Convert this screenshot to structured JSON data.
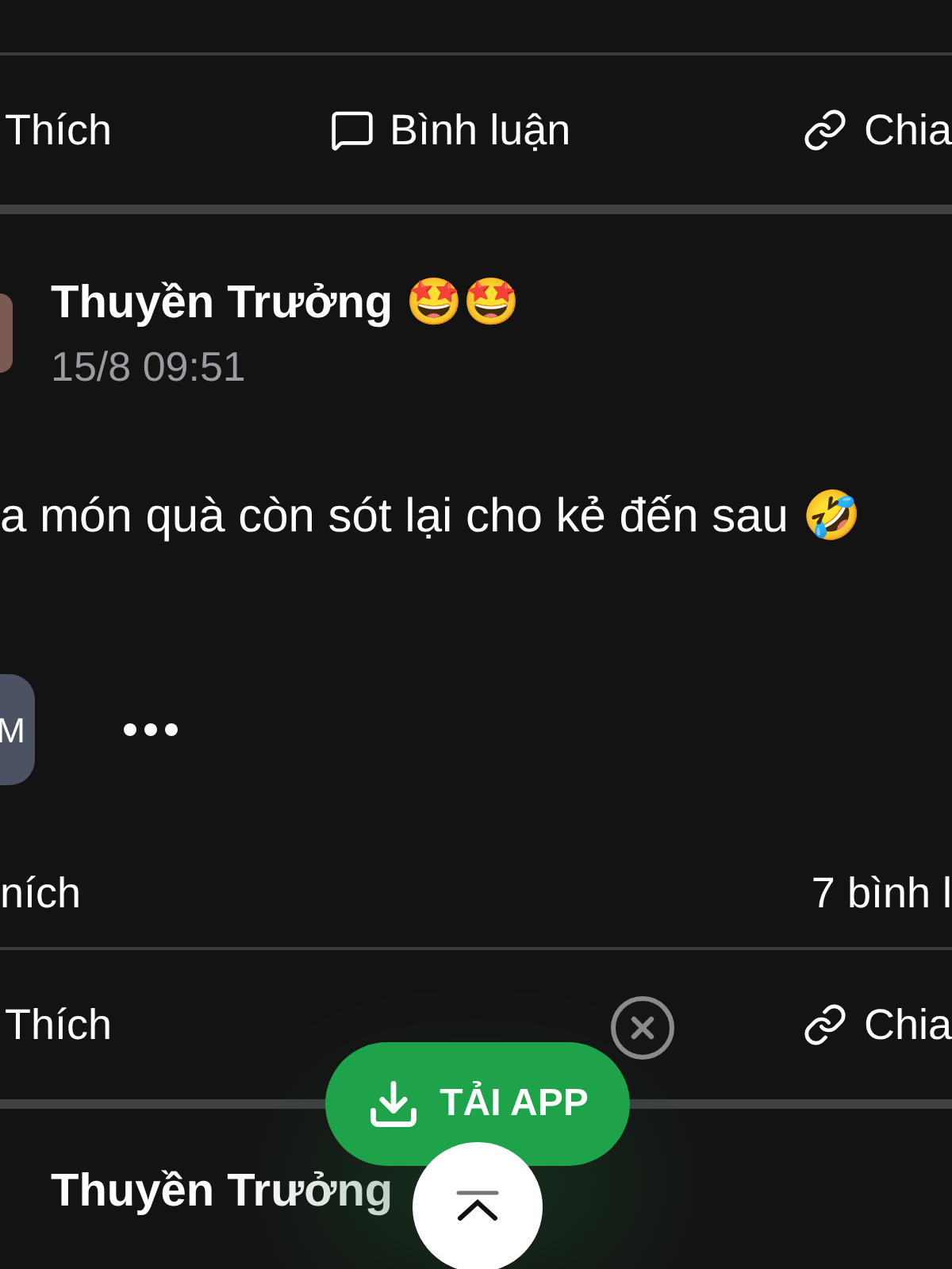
{
  "top_actions": [
    {
      "kind": "like",
      "label": "Thích"
    },
    {
      "kind": "comment",
      "label": "Bình luận"
    },
    {
      "kind": "share",
      "label": "Chia"
    }
  ],
  "post": {
    "author": "Thuyền Trưởng 🤩🤩",
    "time": "15/8 09:51",
    "body": "a món quà còn sót lại cho kẻ đến sau 🤣",
    "chip": "M",
    "likes": "ních",
    "comments": "7 bình l"
  },
  "bottom_actions": [
    {
      "kind": "like",
      "label": "Thích"
    },
    {
      "kind": "share",
      "label": "Chia"
    }
  ],
  "next_post": {
    "author": "Thuyền Trưởng"
  },
  "download_button": {
    "label": "TẢI APP"
  }
}
